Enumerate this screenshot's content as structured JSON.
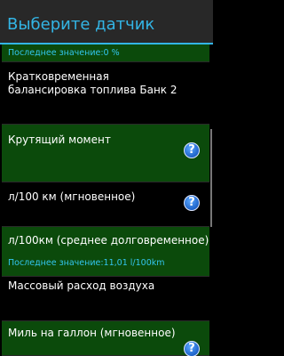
{
  "header": {
    "title": "Выберите датчик"
  },
  "rows": [
    {
      "label": "",
      "sub": "Последнее значение:0 %",
      "highlight": true
    },
    {
      "label": "Кратковременная балансировка топлива Банк 2",
      "sub": "",
      "highlight": false
    },
    {
      "label": "Крутящий момент",
      "sub": "",
      "highlight": true,
      "help": "?"
    },
    {
      "label": "л/100 км (мгновенное)",
      "sub": "",
      "highlight": false,
      "help": "?"
    },
    {
      "label": "л/100км (среднее долговременное)",
      "sub": "Последнее значение:11,01 l/100km",
      "highlight": true
    },
    {
      "label": "Массовый расход воздуха",
      "sub": "",
      "highlight": false
    },
    {
      "label": "Миль на галлон (мгновенное)",
      "sub": "",
      "highlight": true,
      "help": "?"
    }
  ],
  "colors": {
    "accent": "#33b5e5",
    "highlight": "#0b4a0b",
    "help_blue": "#1e63c9"
  },
  "icons": {
    "help": "help-question-icon"
  }
}
